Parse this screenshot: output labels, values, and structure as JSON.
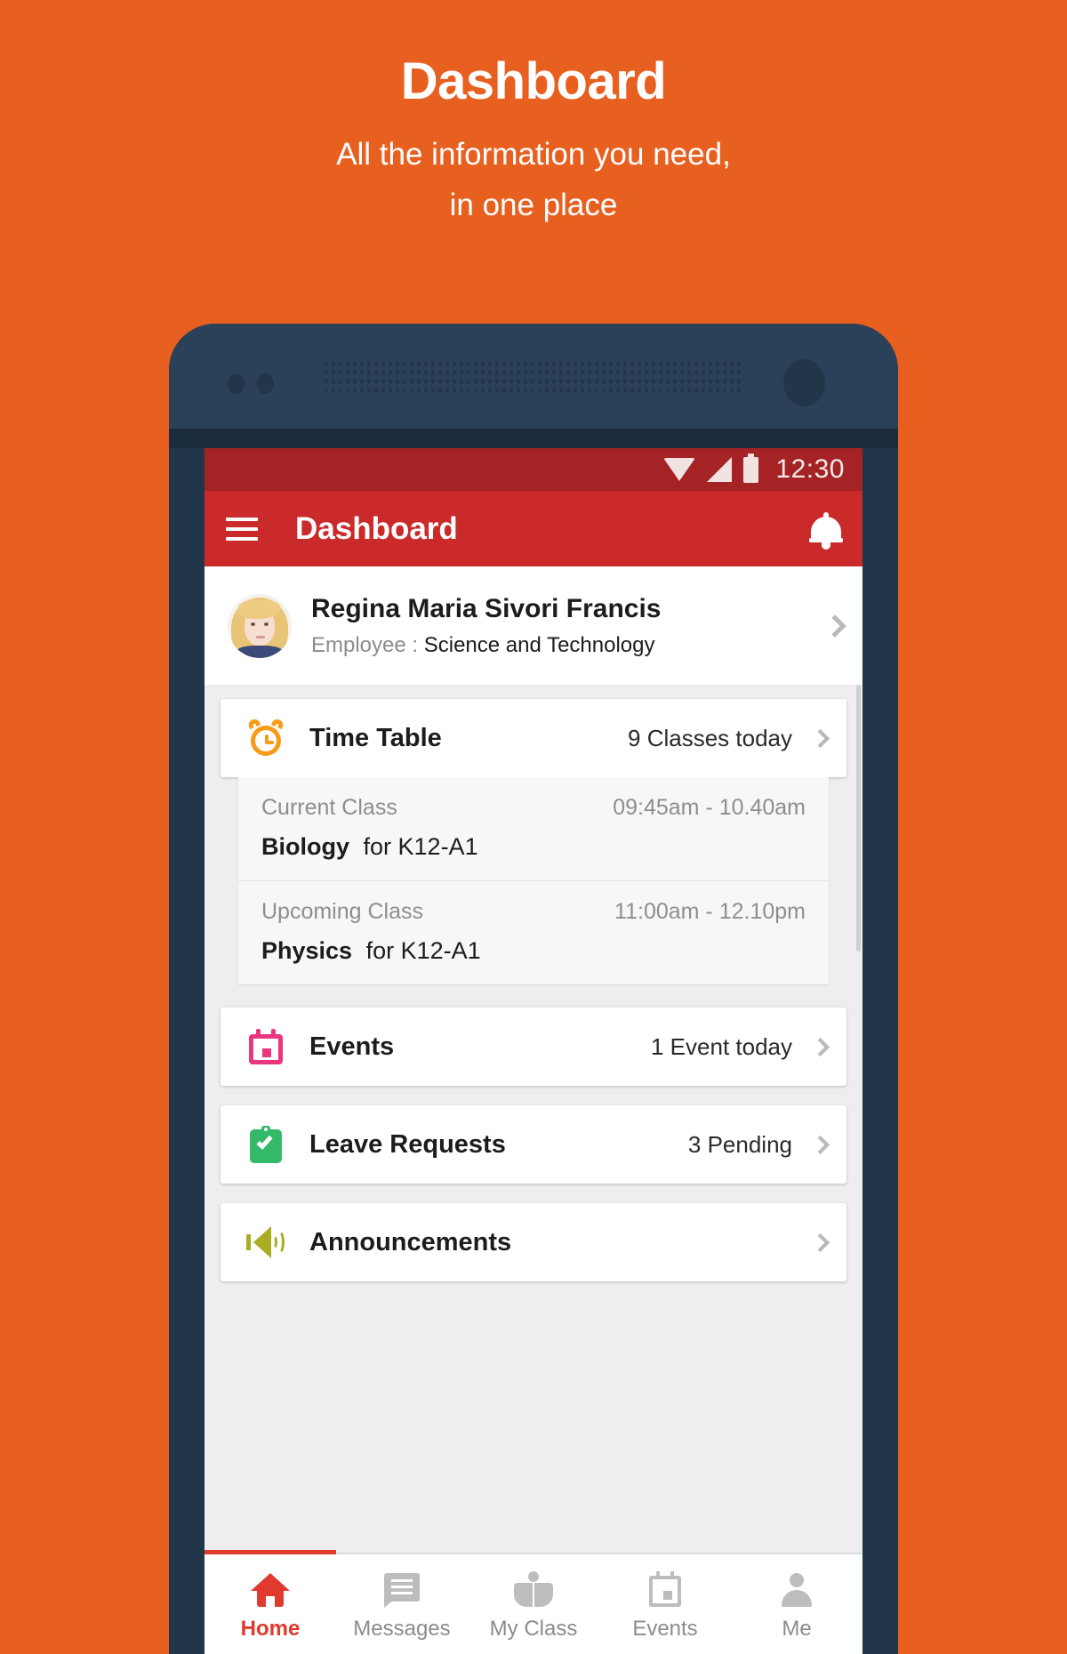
{
  "promo": {
    "title": "Dashboard",
    "subtitle_line1": "All the information you need,",
    "subtitle_line2": "in one place"
  },
  "colors": {
    "background": "#e8601f",
    "app_bar": "#ca2a2a",
    "status_bar": "#a52225",
    "accent_active": "#e03a2f",
    "phone_frame": "#22364a",
    "icon_timetable": "#f79b1b",
    "icon_events": "#e8367f",
    "icon_leave": "#34b96a",
    "icon_announcements": "#a8ad21"
  },
  "status_bar": {
    "time": "12:30",
    "icons": [
      "wifi-icon",
      "signal-icon",
      "battery-icon"
    ]
  },
  "app_bar": {
    "menu_icon": "hamburger-menu-icon",
    "title": "Dashboard",
    "notification_icon": "bell-icon"
  },
  "profile": {
    "avatar": "user-avatar",
    "name": "Regina Maria Sivori Francis",
    "role_label": "Employee :",
    "role_value": "Science and Technology",
    "chevron": "chevron-right-icon"
  },
  "cards": [
    {
      "id": "time-table",
      "icon": "alarm-clock-icon",
      "title": "Time Table",
      "meta": "9 Classes today",
      "chevron": "chevron-right-icon"
    },
    {
      "id": "events",
      "icon": "calendar-icon",
      "title": "Events",
      "meta": "1 Event today",
      "chevron": "chevron-right-icon"
    },
    {
      "id": "leave-requests",
      "icon": "clipboard-check-icon",
      "title": "Leave Requests",
      "meta": "3 Pending",
      "chevron": "chevron-right-icon"
    },
    {
      "id": "announcements",
      "icon": "megaphone-icon",
      "title": "Announcements",
      "meta": "",
      "chevron": "chevron-right-icon"
    }
  ],
  "classes": [
    {
      "label": "Current Class",
      "time": "09:45am - 10.40am",
      "subject": "Biology",
      "group": "for K12-A1"
    },
    {
      "label": "Upcoming Class",
      "time": "11:00am - 12.10pm",
      "subject": "Physics",
      "group": "for K12-A1"
    }
  ],
  "bottom_nav": [
    {
      "id": "home",
      "icon": "home-icon",
      "label": "Home",
      "active": true
    },
    {
      "id": "messages",
      "icon": "message-icon",
      "label": "Messages",
      "active": false
    },
    {
      "id": "myclass",
      "icon": "book-icon",
      "label": "My Class",
      "active": false
    },
    {
      "id": "events",
      "icon": "calendar-icon",
      "label": "Events",
      "active": false
    },
    {
      "id": "me",
      "icon": "person-icon",
      "label": "Me",
      "active": false
    }
  ]
}
